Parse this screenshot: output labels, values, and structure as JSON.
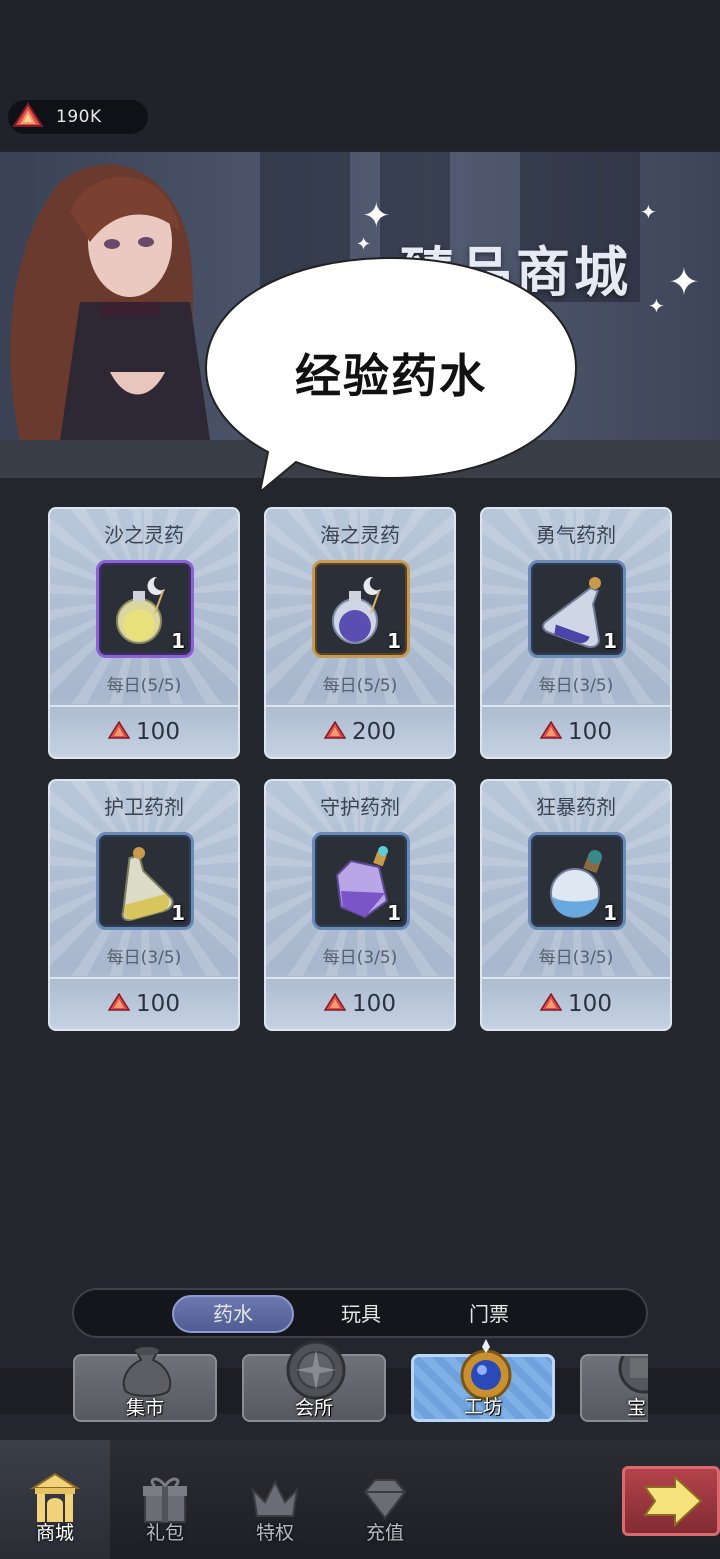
{
  "currency": {
    "amount": "190K",
    "icon": "red-gem-icon"
  },
  "banner": {
    "title": "臻品商城"
  },
  "bubble": {
    "text": "经验药水"
  },
  "items": [
    {
      "name": "沙之灵药",
      "qty": "1",
      "limit": "每日(5/5)",
      "price": "100",
      "frame": "purple",
      "icon": "yellow-round-potion-icon"
    },
    {
      "name": "海之灵药",
      "qty": "1",
      "limit": "每日(5/5)",
      "price": "200",
      "frame": "gold",
      "icon": "purple-round-potion-icon"
    },
    {
      "name": "勇气药剂",
      "qty": "1",
      "limit": "每日(3/5)",
      "price": "100",
      "frame": "blue",
      "icon": "purple-flask-icon"
    },
    {
      "name": "护卫药剂",
      "qty": "1",
      "limit": "每日(3/5)",
      "price": "100",
      "frame": "blue",
      "icon": "yellow-flask-icon"
    },
    {
      "name": "守护药剂",
      "qty": "1",
      "limit": "每日(3/5)",
      "price": "100",
      "frame": "blue",
      "icon": "purple-crystal-potion-icon"
    },
    {
      "name": "狂暴药剂",
      "qty": "1",
      "limit": "每日(3/5)",
      "price": "100",
      "frame": "blue",
      "icon": "blue-round-potion-icon"
    }
  ],
  "subtabs": [
    {
      "label": "药水",
      "active": true
    },
    {
      "label": "玩具",
      "active": false
    },
    {
      "label": "门票",
      "active": false
    }
  ],
  "shop_tabs": [
    {
      "label": "集市",
      "icon": "money-bag-icon",
      "active": false
    },
    {
      "label": "会所",
      "icon": "compass-medallion-icon",
      "active": false
    },
    {
      "label": "工坊",
      "icon": "blue-gear-orb-icon",
      "active": true
    },
    {
      "label": "宝",
      "icon": "treasure-icon",
      "active": false
    }
  ],
  "bottom_nav": [
    {
      "label": "商城",
      "icon": "shop-gate-icon",
      "active": true
    },
    {
      "label": "礼包",
      "icon": "gift-box-icon",
      "active": false
    },
    {
      "label": "特权",
      "icon": "crown-icon",
      "active": false
    },
    {
      "label": "充值",
      "icon": "diamond-icon",
      "active": false
    }
  ],
  "colors": {
    "background": "#23262c",
    "card": "#b9c7da",
    "accent": "#6b79b0",
    "gem": "#d23a4a"
  }
}
